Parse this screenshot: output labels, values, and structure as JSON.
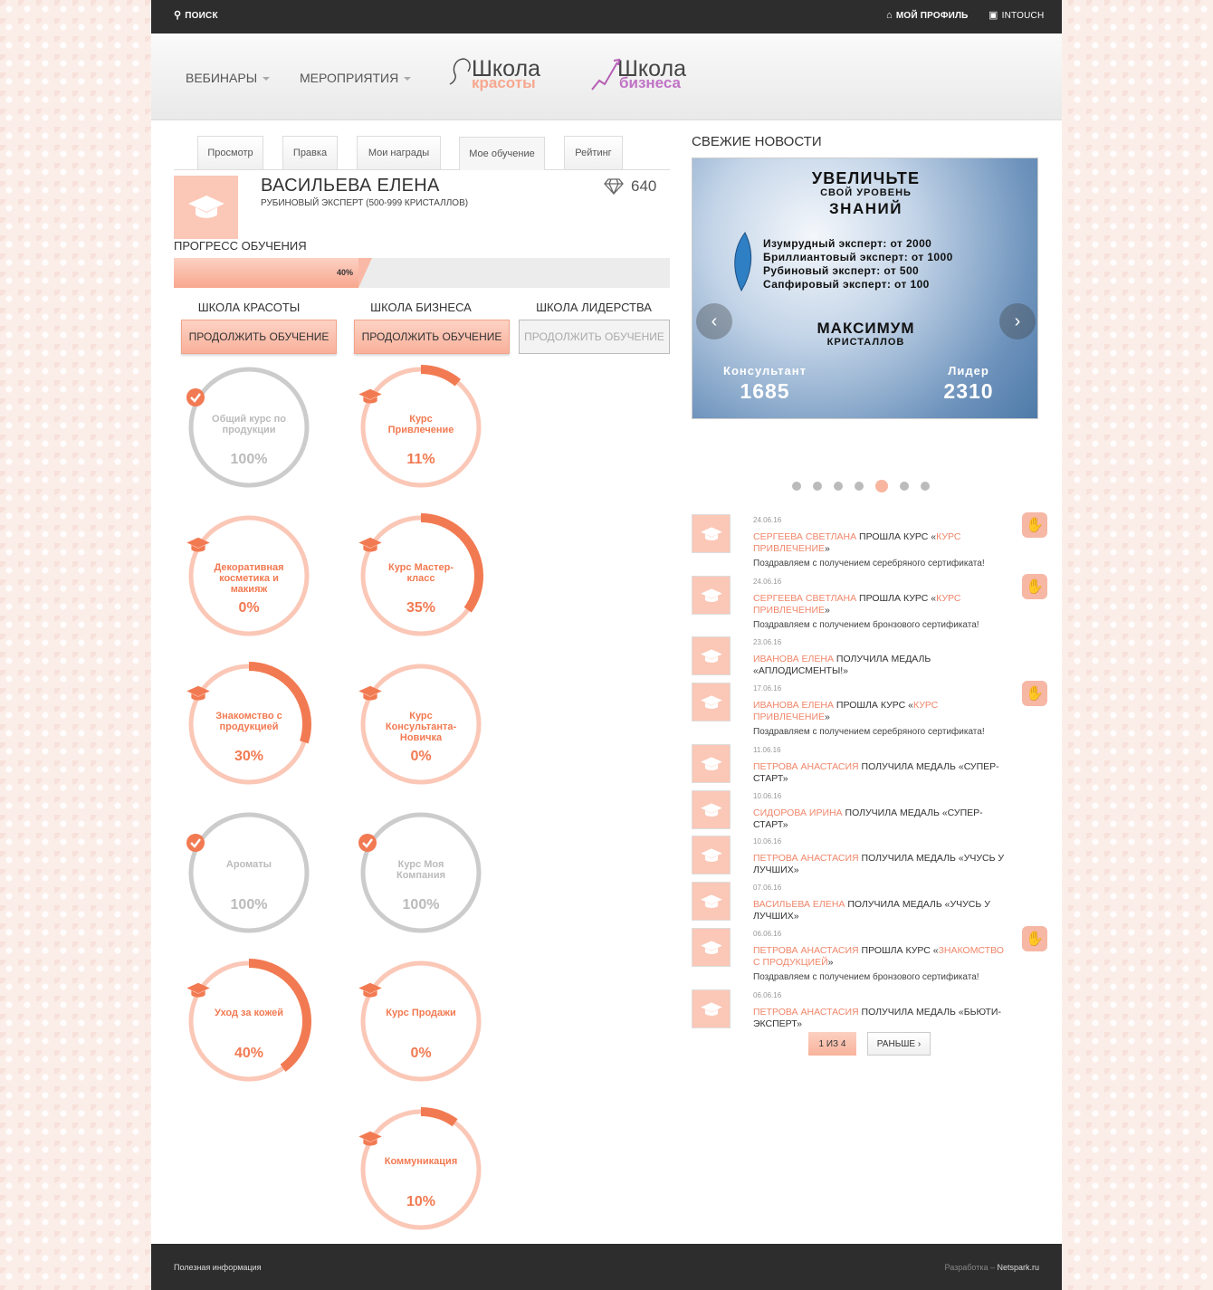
{
  "topbar": {
    "search": "поиск",
    "profile": "мой профиль",
    "intouch": "INTOUCH"
  },
  "header": {
    "nav": [
      "ВЕБИНАРЫ",
      "МЕРОПРИЯТИЯ"
    ],
    "logo_beauty": {
      "word": "Школа",
      "sub": "красоты"
    },
    "logo_business": {
      "word": "Школа",
      "sub": "бизнеса"
    }
  },
  "tabs": [
    "Просмотр",
    "Правка",
    "Мои награды",
    "Мое обучение",
    "Рейтинг"
  ],
  "profile": {
    "name": "ВАСИЛЬЕВА ЕЛЕНА",
    "rank": "РУБИНОВЫЙ ЭКСПЕРТ (500-999 КРИСТАЛЛОВ)",
    "crystals": "640"
  },
  "progress": {
    "title": "ПРОГРЕСС ОБУЧЕНИЯ",
    "label": "40%",
    "value": 0.4
  },
  "schools": [
    {
      "title": "ШКОЛА КРАСОТЫ",
      "button": "ПРОДОЛЖИТЬ ОБУЧЕНИЕ"
    },
    {
      "title": "ШКОЛА БИЗНЕСА",
      "button": "ПРОДОЛЖИТЬ ОБУЧЕНИЕ"
    },
    {
      "title": "ШКОЛА ЛИДЕРСТВА",
      "button": "ПРОДОЛЖИТЬ ОБУЧЕНИЕ"
    }
  ],
  "courses_left": [
    {
      "name": "Общий курс по продукции",
      "pct": "100%",
      "value": 1.0,
      "done": true
    },
    {
      "name": "Декоративная косметика и макияж",
      "pct": "0%",
      "value": 0.0,
      "done": false
    },
    {
      "name": "Знакомство с продукцией",
      "pct": "30%",
      "value": 0.3,
      "done": false
    },
    {
      "name": "Ароматы",
      "pct": "100%",
      "value": 1.0,
      "done": true
    },
    {
      "name": "Уход за кожей",
      "pct": "40%",
      "value": 0.4,
      "done": false
    }
  ],
  "courses_right": [
    {
      "name": "Курс Привлечение",
      "pct": "11%",
      "value": 0.11,
      "done": false
    },
    {
      "name": "Курс Мастер-класс",
      "pct": "35%",
      "value": 0.35,
      "done": false
    },
    {
      "name": "Курс Консультанта-Новичка",
      "pct": "0%",
      "value": 0.0,
      "done": false
    },
    {
      "name": "Курс Моя Компания",
      "pct": "100%",
      "value": 1.0,
      "done": true
    },
    {
      "name": "Курс Продажи",
      "pct": "0%",
      "value": 0.0,
      "done": false
    },
    {
      "name": "Коммуникация",
      "pct": "10%",
      "value": 0.1,
      "done": false
    }
  ],
  "news": {
    "title": "СВЕЖИЕ НОВОСТИ",
    "slide": {
      "l1": "УВЕЛИЧЬТЕ",
      "l2": "СВОЙ УРОВЕНЬ",
      "l3": "ЗНАНИЙ",
      "levels": [
        "Изумрудный эксперт: от 2000",
        "Бриллиантовый эксперт: от 1000",
        "Рубиновый эксперт: от 500",
        "Сапфировый эксперт: от 100"
      ],
      "max1": "МАКСИМУМ",
      "max2": "КРИСТАЛЛОВ",
      "c_label": "Консультант",
      "c_value": "1685",
      "l_label": "Лидер",
      "l_value": "2310"
    },
    "dots_count": 7,
    "dots_active": 4
  },
  "feed": [
    {
      "date": "24.06.16",
      "name": "СЕРГЕЕВА СВЕТЛАНА",
      "action": " ПРОШЛА КУРС «",
      "course": "КУРС ПРИВЛЕЧЕНИЕ",
      "end": "»",
      "sub": "Поздравляем с получением серебряного сертификата!",
      "badge": true
    },
    {
      "date": "24.06.16",
      "name": "СЕРГЕЕВА СВЕТЛАНА",
      "action": " ПРОШЛА КУРС «",
      "course": "КУРС ПРИВЛЕЧЕНИЕ",
      "end": "»",
      "sub": "Поздравляем с получением бронзового сертификата!",
      "badge": true
    },
    {
      "date": "23.06.16",
      "name": "ИВАНОВА ЕЛЕНА",
      "action": " ПОЛУЧИЛА МЕДАЛЬ «АПЛОДИСМЕНТЫ!»",
      "course": "",
      "end": "",
      "sub": "",
      "badge": false
    },
    {
      "date": "17.06.16",
      "name": "ИВАНОВА ЕЛЕНА",
      "action": " ПРОШЛА КУРС «",
      "course": "КУРС ПРИВЛЕЧЕНИЕ",
      "end": "»",
      "sub": "Поздравляем с получением серебряного сертификата!",
      "badge": true
    },
    {
      "date": "11.06.16",
      "name": "ПЕТРОВА АНАСТАСИЯ",
      "action": " ПОЛУЧИЛА МЕДАЛЬ «СУПЕР-СТАРТ»",
      "course": "",
      "end": "",
      "sub": "",
      "badge": false
    },
    {
      "date": "10.06.16",
      "name": "СИДОРОВА ИРИНА",
      "action": " ПОЛУЧИЛА МЕДАЛЬ «СУПЕР-СТАРТ»",
      "course": "",
      "end": "",
      "sub": "",
      "badge": false
    },
    {
      "date": "10.06.16",
      "name": "ПЕТРОВА АНАСТАСИЯ",
      "action": " ПОЛУЧИЛА МЕДАЛЬ «УЧУСЬ У ЛУЧШИХ»",
      "course": "",
      "end": "",
      "sub": "",
      "badge": false
    },
    {
      "date": "07.06.16",
      "name": "ВАСИЛЬЕВА ЕЛЕНА",
      "action": " ПОЛУЧИЛА МЕДАЛЬ «УЧУСЬ У ЛУЧШИХ»",
      "course": "",
      "end": "",
      "sub": "",
      "badge": false
    },
    {
      "date": "06.06.16",
      "name": "ПЕТРОВА АНАСТАСИЯ",
      "action": " ПРОШЛА КУРС «",
      "course": "ЗНАКОМСТВО С ПРОДУКЦИЕЙ",
      "end": "»",
      "sub": "Поздравляем с получением бронзового сертификата!",
      "badge": true
    },
    {
      "date": "06.06.16",
      "name": "ПЕТРОВА АНАСТАСИЯ",
      "action": " ПОЛУЧИЛА МЕДАЛЬ «БЬЮТИ-ЭКСПЕРТ»",
      "course": "",
      "end": "",
      "sub": "",
      "badge": false
    }
  ],
  "pager": {
    "current": "1 ИЗ 4",
    "next": "РАНЬШЕ ›"
  },
  "footer": {
    "left": "Полезная информация",
    "dev_label": "Разработка – ",
    "dev_name": "Netspark.ru"
  },
  "colors": {
    "accent": "#f27a52",
    "accent_light": "#fbc7b6",
    "grey": "#cccccc",
    "dark": "#2d2d2d"
  }
}
